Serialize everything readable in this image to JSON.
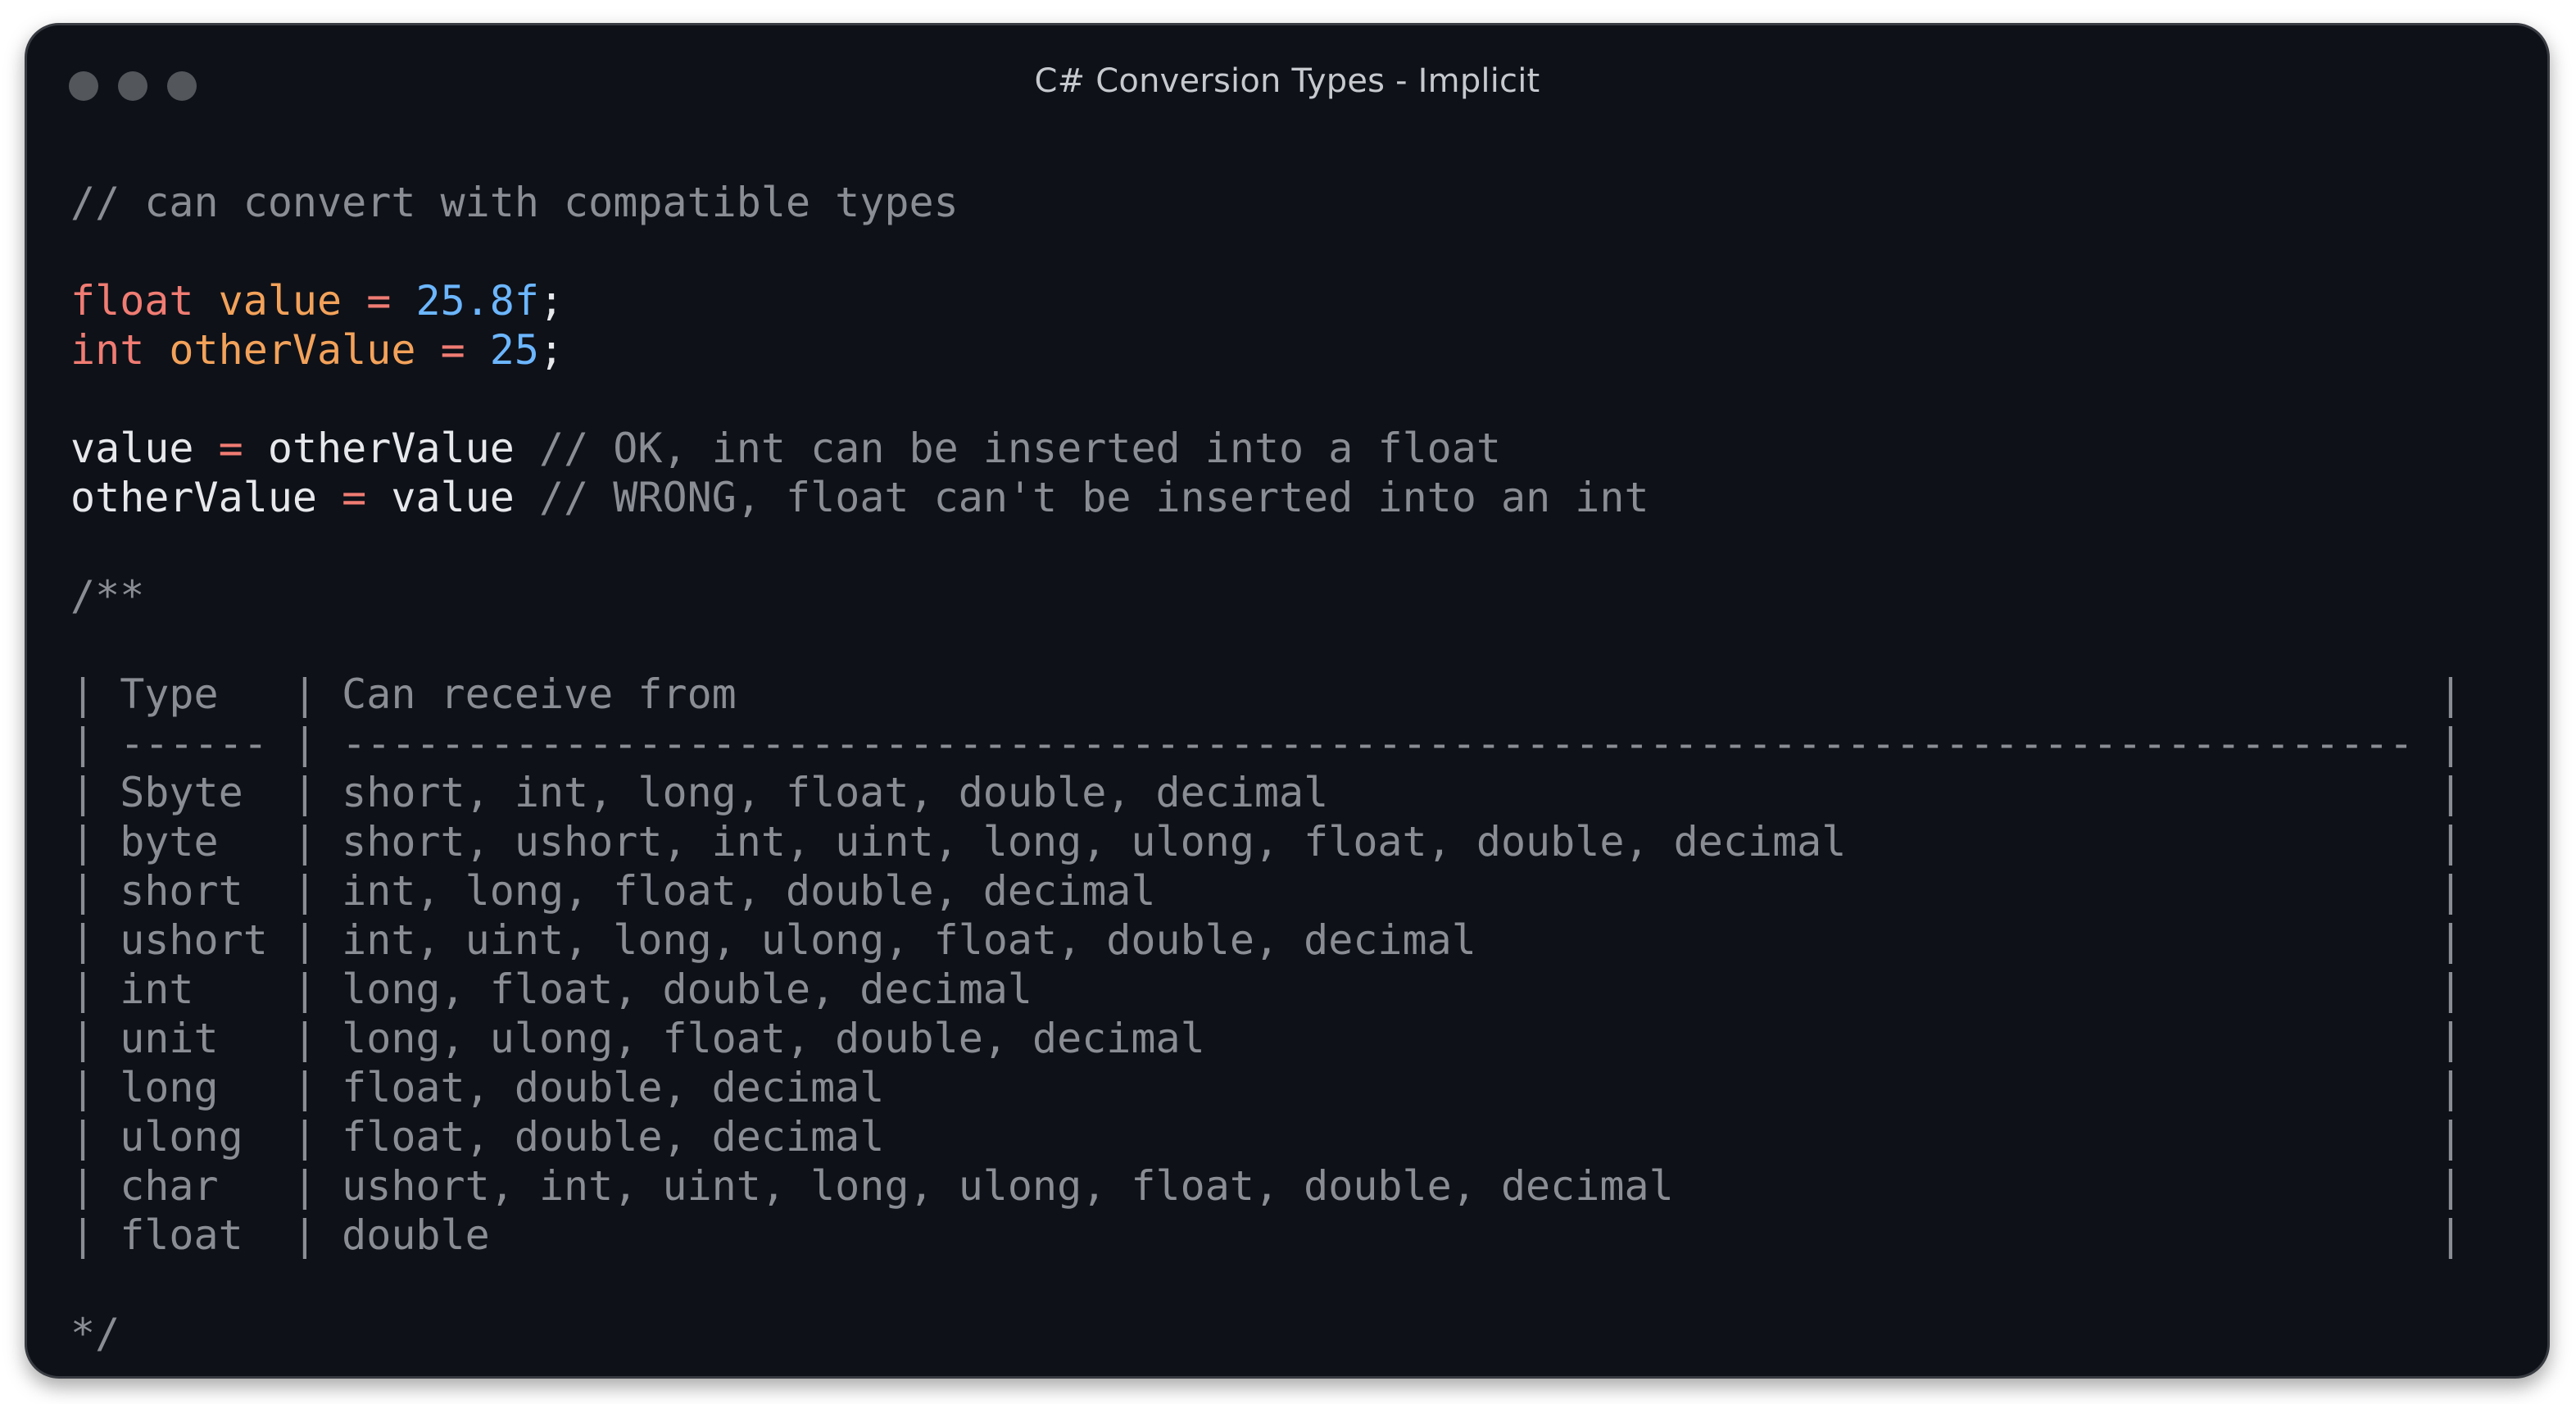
{
  "window": {
    "title": "C# Conversion Types - Implicit"
  },
  "code": {
    "comment_line": "// can convert with compatible types",
    "decl_float": {
      "type": "float",
      "name": "value",
      "op": "=",
      "val": "25.8f",
      "end": ";"
    },
    "decl_int": {
      "type": "int",
      "name": "otherValue",
      "op": "=",
      "val": "25",
      "end": ";"
    },
    "assign_ok": {
      "lhs": "value",
      "op": "=",
      "rhs": "otherValue",
      "comment": "// OK, int can be inserted into a float"
    },
    "assign_wrong": {
      "lhs": "otherValue",
      "op": "=",
      "rhs": "value",
      "comment": "// WRONG, float can't be inserted into an int"
    },
    "block_open": "/**",
    "table_lines": [
      "| Type   | Can receive from                                                                     |",
      "| ------ | ------------------------------------------------------------------------------------ |",
      "| Sbyte  | short, int, long, float, double, decimal                                             |",
      "| byte   | short, ushort, int, uint, long, ulong, float, double, decimal                        |",
      "| short  | int, long, float, double, decimal                                                    |",
      "| ushort | int, uint, long, ulong, float, double, decimal                                       |",
      "| int    | long, float, double, decimal                                                         |",
      "| unit   | long, ulong, float, double, decimal                                                  |",
      "| long   | float, double, decimal                                                               |",
      "| ulong  | float, double, decimal                                                               |",
      "| char   | ushort, int, uint, long, ulong, float, double, decimal                               |",
      "| float  | double                                                                               |"
    ],
    "block_close": "*/"
  },
  "colors": {
    "background": "#0e1118",
    "keyword": "#f07c73",
    "variable": "#f3a25a",
    "number": "#6cb6ff",
    "comment": "#8a8e94",
    "text": "#e6e8eb"
  }
}
